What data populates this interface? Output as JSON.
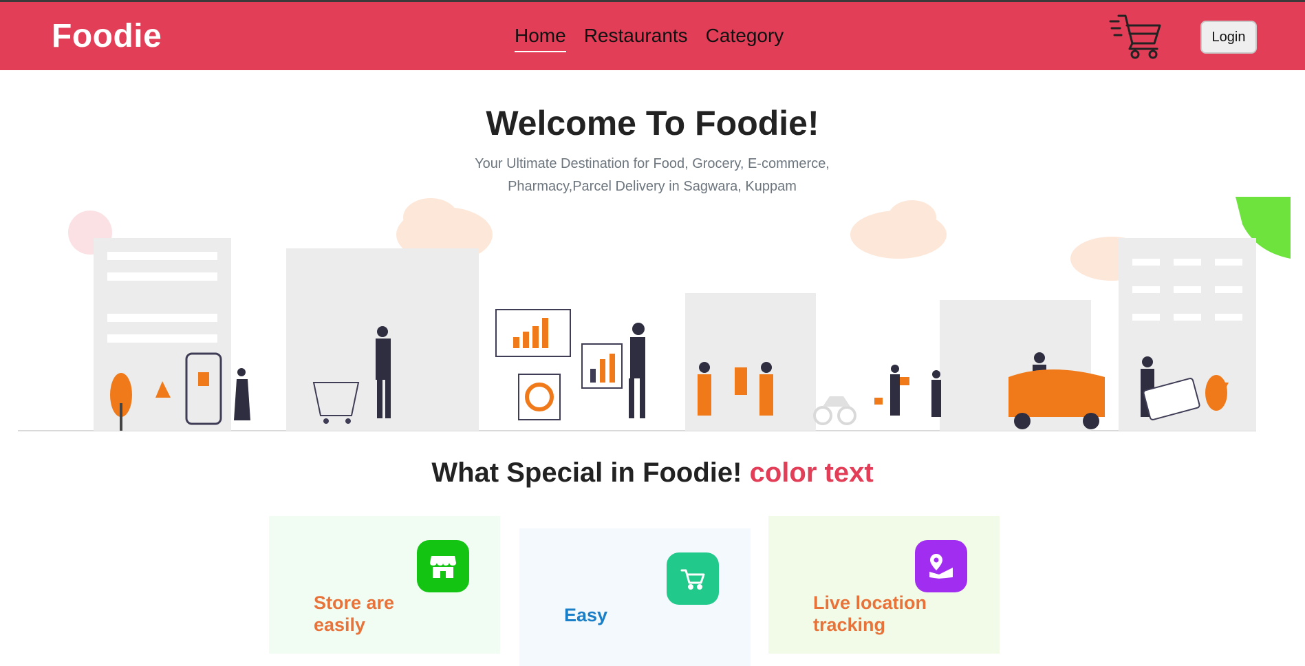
{
  "navbar": {
    "brand": "Foodie",
    "links": [
      {
        "label": "Home",
        "active": true
      },
      {
        "label": "Restaurants",
        "active": false
      },
      {
        "label": "Category",
        "active": false
      }
    ],
    "cart_icon": "shopping-cart-icon",
    "login_label": "Login"
  },
  "hero": {
    "title": "Welcome To Foodie!",
    "subtitle": "Your Ultimate Destination for Food, Grocery, E-commerce, Pharmacy,Parcel Delivery in Sagwara, Kuppam"
  },
  "special": {
    "title_main": "What Special in Foodie!",
    "title_accent": "color text"
  },
  "features": [
    {
      "title": "Store are easily",
      "icon": "store-icon",
      "icon_color": "#13c413",
      "title_color": "#e8733a"
    },
    {
      "title": "Easy",
      "icon": "cart-icon",
      "icon_color": "#21c98a",
      "title_color": "#1a7fc7"
    },
    {
      "title": "Live location tracking",
      "icon": "map-location-icon",
      "icon_color": "#a12df0",
      "title_color": "#e8733a"
    }
  ],
  "colors": {
    "brand": "#e23e57",
    "accent_orange": "#f07a1a"
  }
}
